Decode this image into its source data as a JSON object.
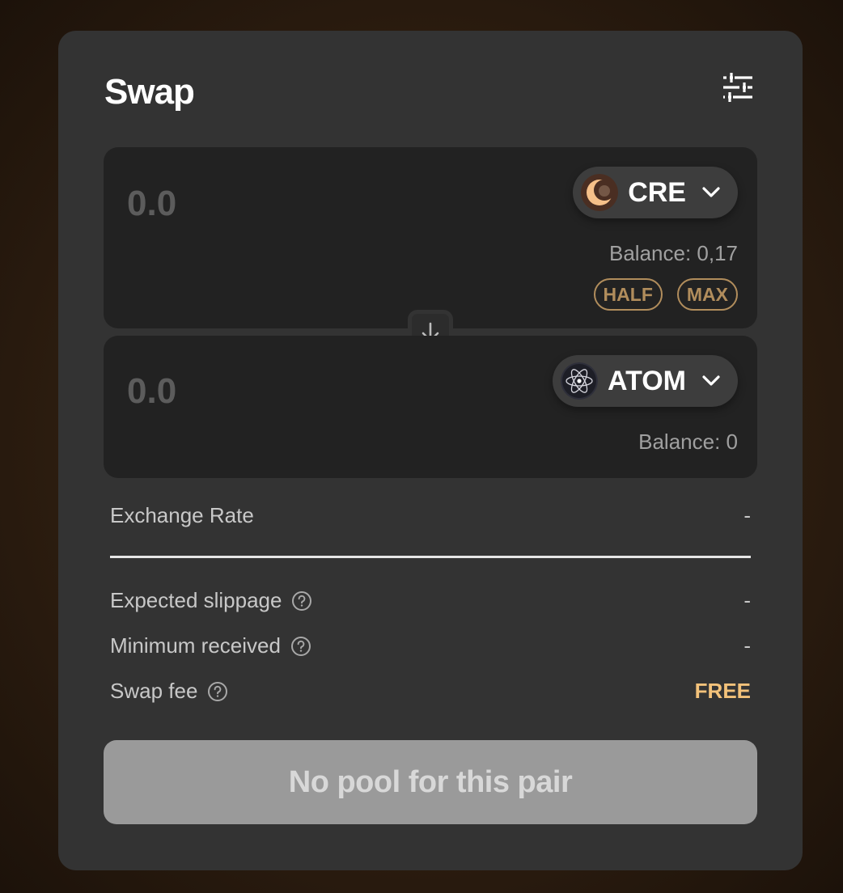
{
  "header": {
    "title": "Swap",
    "settings_icon": "sliders-icon"
  },
  "from": {
    "amount_placeholder": "0.0",
    "token": "CRE",
    "balance": "Balance: 0,17",
    "half_label": "HALF",
    "max_label": "MAX"
  },
  "to": {
    "amount_placeholder": "0.0",
    "token": "ATOM",
    "balance": "Balance: 0"
  },
  "details": {
    "exchange_rate_label": "Exchange Rate",
    "exchange_rate_value": "-",
    "slippage_label": "Expected slippage",
    "slippage_value": "-",
    "min_received_label": "Minimum received",
    "min_received_value": "-",
    "fee_label": "Swap fee",
    "fee_value": "FREE"
  },
  "action": {
    "button_label": "No pool for this pair"
  },
  "colors": {
    "accent": "#b18d5c",
    "free": "#f3c27a",
    "card": "#333333",
    "panel": "#222222"
  }
}
